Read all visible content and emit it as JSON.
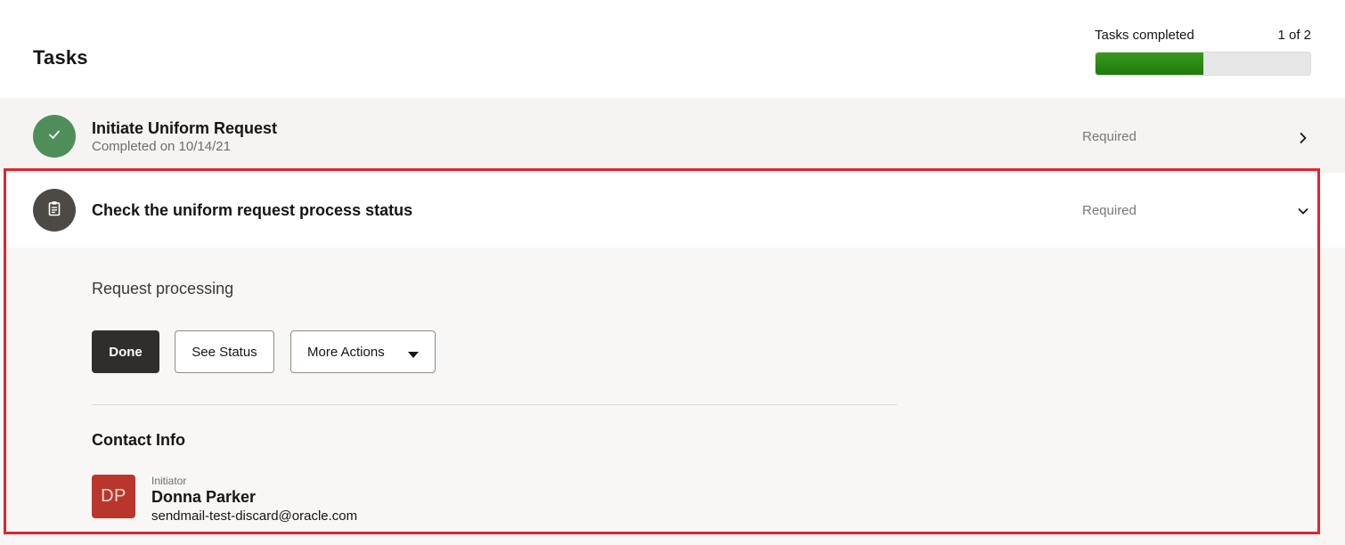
{
  "header": {
    "title": "Tasks",
    "progress_label": "Tasks completed",
    "progress_count": "1 of 2",
    "progress_fraction": 0.5,
    "progress_color": "#1f7a0c"
  },
  "tasks": [
    {
      "title": "Initiate Uniform Request",
      "subtitle": "Completed on 10/14/21",
      "requirement": "Required",
      "icon": "checkmark-icon",
      "icon_color": "#4f8e58",
      "state": "completed",
      "expanded": false
    },
    {
      "title": "Check the uniform request process status",
      "requirement": "Required",
      "icon": "clipboard-icon",
      "icon_color": "#4d4945",
      "state": "in-progress",
      "expanded": true
    }
  ],
  "detail": {
    "status_text": "Request processing",
    "buttons": {
      "done": "Done",
      "see_status": "See Status",
      "more_actions": "More Actions"
    },
    "contact": {
      "heading": "Contact Info",
      "initials": "DP",
      "avatar_color": "#b8362b",
      "role": "Initiator",
      "name": "Donna Parker",
      "email": "sendmail-test-discard@oracle.com"
    }
  },
  "highlight_color": "#e0242f"
}
